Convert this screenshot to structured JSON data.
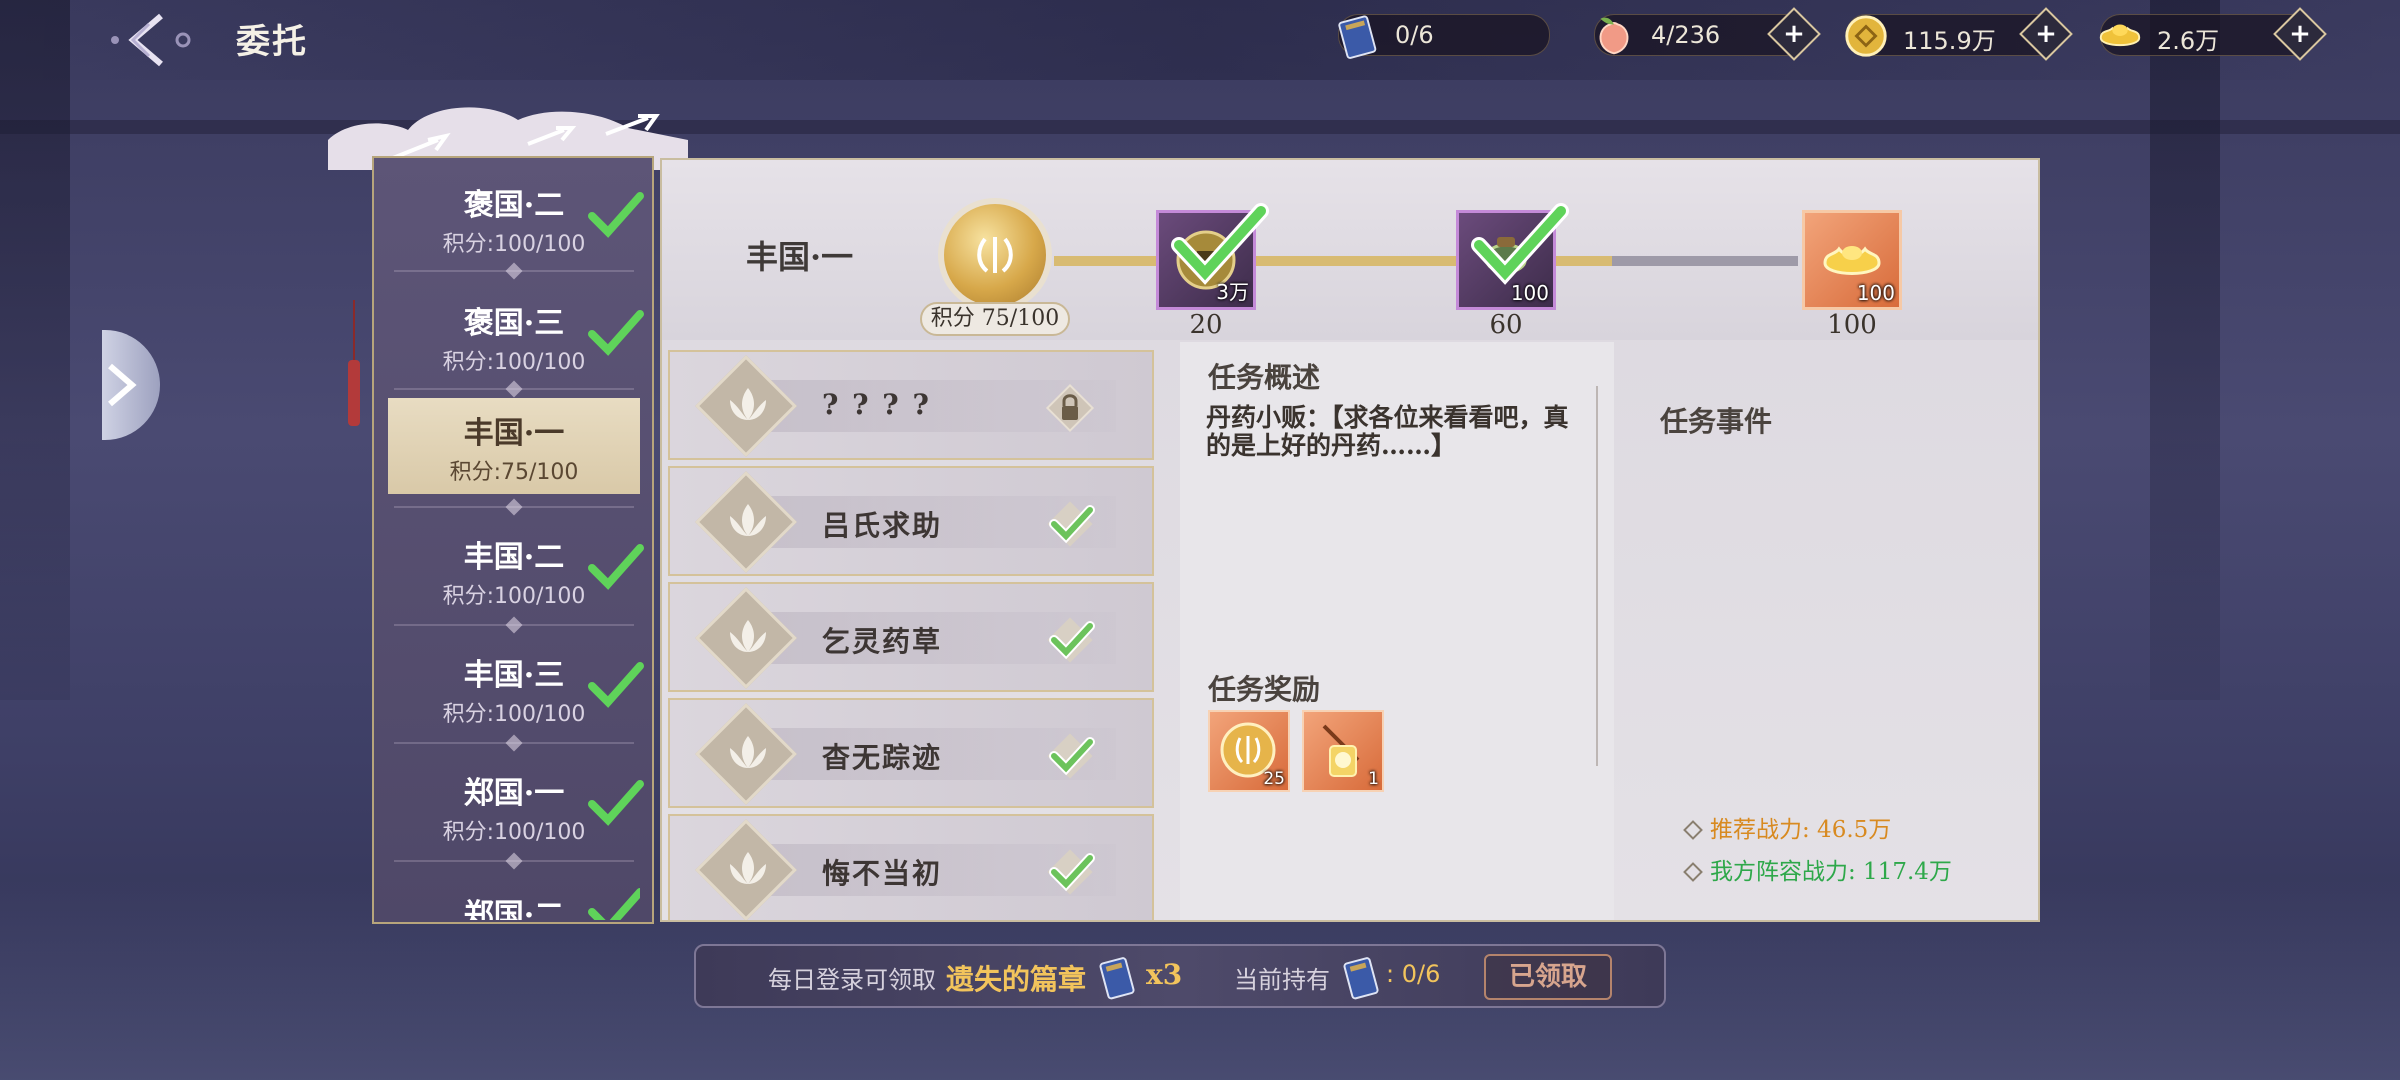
{
  "header": {
    "title": "委托",
    "resources": [
      {
        "icon": "book-icon",
        "value": "0/6",
        "has_plus": false
      },
      {
        "icon": "peach-icon",
        "value": "4/236",
        "has_plus": true
      },
      {
        "icon": "coin-icon",
        "value": "115.9万",
        "has_plus": true
      },
      {
        "icon": "gold-ingot-icon",
        "value": "2.6万",
        "has_plus": true
      }
    ]
  },
  "chapters": [
    {
      "name": "褒国·二",
      "score": "积分:100/100",
      "done": true
    },
    {
      "name": "褒国·三",
      "score": "积分:100/100",
      "done": true
    },
    {
      "name": "丰国·一",
      "score": "积分:75/100",
      "done": false,
      "active": true
    },
    {
      "name": "丰国·二",
      "score": "积分:100/100",
      "done": true
    },
    {
      "name": "丰国·三",
      "score": "积分:100/100",
      "done": true
    },
    {
      "name": "郑国·一",
      "score": "积分:100/100",
      "done": true
    },
    {
      "name": "郑国·二",
      "score": "",
      "done": true
    }
  ],
  "current_chapter": {
    "title": "丰国·一",
    "points_label": "积分 75/100",
    "points": 75,
    "points_max": 100,
    "milestones": [
      {
        "threshold": "20",
        "count": "3万",
        "claimed": true,
        "style": "purple",
        "icon": "copper-coin-icon"
      },
      {
        "threshold": "60",
        "count": "100",
        "claimed": true,
        "style": "purple",
        "icon": "pouch-icon"
      },
      {
        "threshold": "100",
        "count": "100",
        "claimed": false,
        "style": "orange",
        "icon": "gold-ingot-icon"
      }
    ]
  },
  "tasks": [
    {
      "name": "? ? ? ?",
      "status": "locked"
    },
    {
      "name": "吕氏求助",
      "status": "done"
    },
    {
      "name": "乞灵药草",
      "status": "done"
    },
    {
      "name": "杳无踪迹",
      "status": "done"
    },
    {
      "name": "悔不当初",
      "status": "done"
    }
  ],
  "detail": {
    "overview_title": "任务概述",
    "overview_text": "丹药小贩：【求各位来看看吧，真的是上好的丹药……】",
    "events_title": "任务事件",
    "rewards_title": "任务奖励",
    "rewards": [
      {
        "icon": "gold-medal-icon",
        "count": "25"
      },
      {
        "icon": "lantern-icon",
        "count": "1"
      }
    ],
    "recommended_power": "推荐战力: 46.5万",
    "my_power": "我方阵容战力: 117.4万"
  },
  "bottom_bar": {
    "daily_text": "每日登录可领取",
    "item_name": "遗失的篇章",
    "item_qty": "x3",
    "holding_label": "当前持有",
    "holding_value": ": 0/6",
    "claim_button": "已领取"
  },
  "colors": {
    "gold": "#f2c45c",
    "green_check": "#5fd35a",
    "recommended": "#d88a20",
    "mine": "#2ea84a"
  }
}
